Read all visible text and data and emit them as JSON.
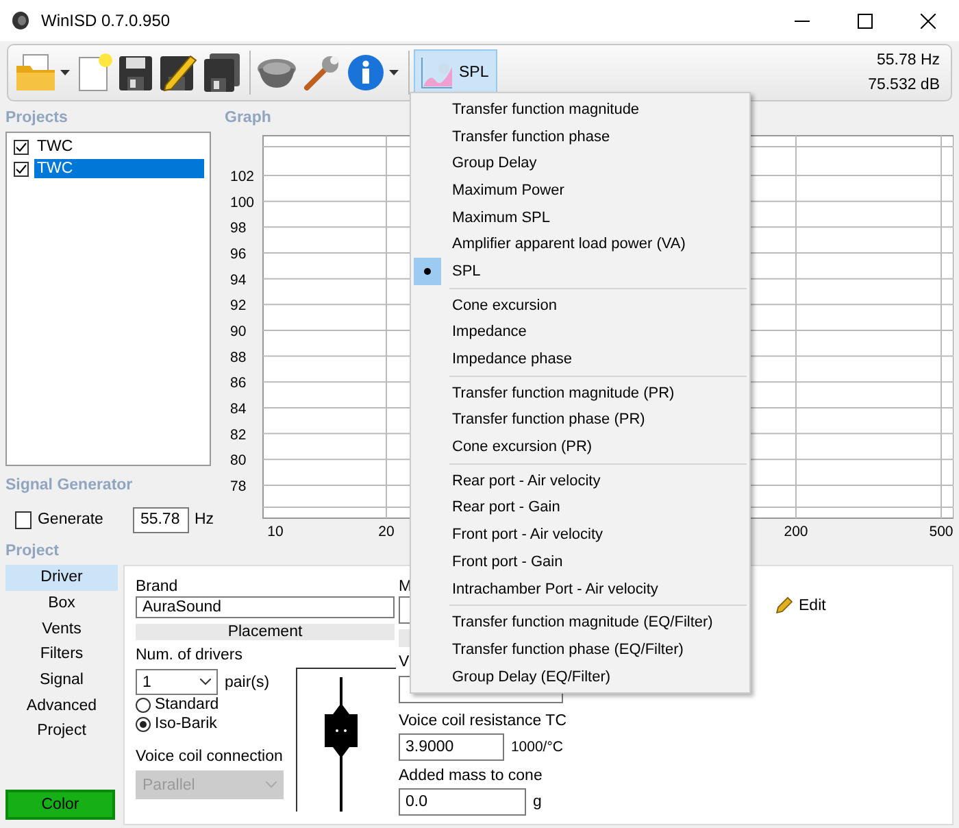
{
  "window": {
    "title": "WinISD 0.7.0.950"
  },
  "toolbar": {
    "graph_button": {
      "label": "SPL"
    },
    "readouts": [
      "55.78 Hz",
      "75.532 dB"
    ]
  },
  "projects": {
    "label": "Projects",
    "items": [
      {
        "name": "TWC",
        "checked": true,
        "selected": false
      },
      {
        "name": "TWC",
        "checked": true,
        "selected": true
      }
    ]
  },
  "graph": {
    "label": "Graph",
    "y_ticks": [
      "102",
      "100",
      "98",
      "96",
      "94",
      "92",
      "90",
      "88",
      "86",
      "84",
      "82",
      "80",
      "78"
    ],
    "x_ticks": [
      "10",
      "20",
      "200",
      "500"
    ]
  },
  "signal_generator": {
    "label": "Signal Generator",
    "generate": {
      "label": "Generate",
      "checked": false
    },
    "frequency": "55.78",
    "unit": "Hz"
  },
  "project": {
    "label": "Project",
    "tabs": [
      {
        "label": "Driver",
        "selected": true
      },
      {
        "label": "Box",
        "selected": false
      },
      {
        "label": "Vents",
        "selected": false
      },
      {
        "label": "Filters",
        "selected": false
      },
      {
        "label": "Signal",
        "selected": false
      },
      {
        "label": "Advanced",
        "selected": false
      },
      {
        "label": "Project",
        "selected": false
      }
    ],
    "color_button": "Color",
    "driver": {
      "brand_label": "Brand",
      "brand": "AuraSound",
      "placement": "Placement",
      "num_label": "Num. of drivers",
      "num": "1",
      "num_unit": "pair(s)",
      "modes": [
        {
          "label": "Standard",
          "selected": false
        },
        {
          "label": "Iso-Barik",
          "selected": true
        }
      ],
      "connection_label": "Voice coil connection",
      "connection": "Parallel",
      "connection_disabled": true,
      "partial_labels": [
        "M",
        "V"
      ],
      "vc_tc_label": "Voice coil resistance TC",
      "vc_tc": "3.9000",
      "vc_tc_unit": "1000/°C",
      "mass_label": "Added mass to cone",
      "mass": "0.0",
      "mass_unit": "g",
      "edit_button": "Edit"
    }
  },
  "graph_menu": {
    "groups": [
      [
        {
          "label": "Transfer function magnitude",
          "selected": false
        },
        {
          "label": "Transfer function phase",
          "selected": false
        },
        {
          "label": "Group Delay",
          "selected": false
        },
        {
          "label": "Maximum Power",
          "selected": false
        },
        {
          "label": "Maximum SPL",
          "selected": false
        },
        {
          "label": "Amplifier apparent load power (VA)",
          "selected": false
        },
        {
          "label": "SPL",
          "selected": true
        }
      ],
      [
        {
          "label": "Cone excursion",
          "selected": false
        },
        {
          "label": "Impedance",
          "selected": false
        },
        {
          "label": "Impedance phase",
          "selected": false
        }
      ],
      [
        {
          "label": "Transfer function magnitude (PR)",
          "selected": false
        },
        {
          "label": "Transfer function phase (PR)",
          "selected": false
        },
        {
          "label": "Cone excursion (PR)",
          "selected": false
        }
      ],
      [
        {
          "label": "Rear port - Air velocity",
          "selected": false
        },
        {
          "label": "Rear port - Gain",
          "selected": false
        },
        {
          "label": "Front port - Air velocity",
          "selected": false
        },
        {
          "label": "Front port - Gain",
          "selected": false
        },
        {
          "label": "Intrachamber Port - Air velocity",
          "selected": false
        }
      ],
      [
        {
          "label": "Transfer function magnitude (EQ/Filter)",
          "selected": false
        },
        {
          "label": "Transfer function phase (EQ/Filter)",
          "selected": false
        },
        {
          "label": "Group Delay (EQ/Filter)",
          "selected": false
        }
      ]
    ]
  }
}
